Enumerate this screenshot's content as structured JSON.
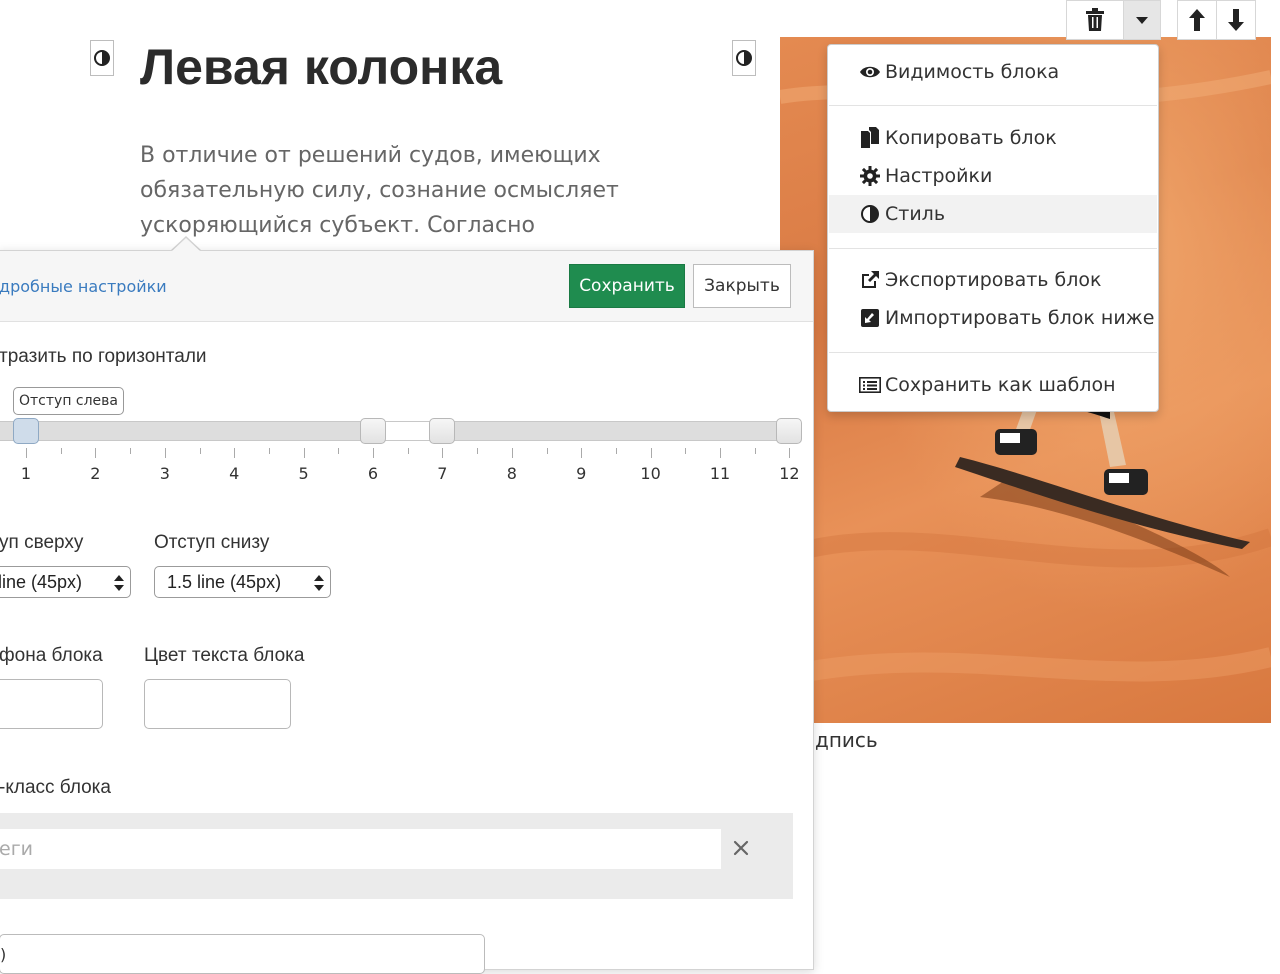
{
  "content": {
    "heading": "Левая колонка",
    "paragraph_lines": [
      "В отличие от решений судов, имеющих",
      "обязательную силу, сознание осмысляет",
      "ускоряющийся субъект. Согласно"
    ],
    "image_caption": "дпись"
  },
  "block_toolbar": {
    "icons": [
      "trash-icon",
      "caret-down-icon",
      "arrow-up-icon",
      "arrow-down-icon"
    ]
  },
  "block_menu": {
    "items": [
      {
        "label": "Видимость блока",
        "icon": "eye-icon"
      },
      {
        "label": "Копировать блок",
        "icon": "copy-icon"
      },
      {
        "label": "Настройки",
        "icon": "gear-icon"
      },
      {
        "label": "Стиль",
        "icon": "contrast-icon",
        "highlighted": true
      },
      {
        "label": "Экспортировать блок",
        "icon": "external-link-icon"
      },
      {
        "label": "Импортировать блок ниже",
        "icon": "import-icon"
      },
      {
        "label": "Сохранить как шаблон",
        "icon": "list-icon"
      }
    ]
  },
  "settings_panel": {
    "advanced_link": "дробные настройки",
    "save_label": "Сохранить",
    "close_label": "Закрыть",
    "mirror_label": "тразить по горизонтали",
    "slider": {
      "tooltip": "Отступ слева",
      "min": 0,
      "max": 12,
      "ticks": [
        "1",
        "2",
        "3",
        "4",
        "5",
        "6",
        "7",
        "8",
        "9",
        "10",
        "11",
        "12"
      ],
      "handles": [
        1,
        6,
        7,
        12
      ]
    },
    "padding_top": {
      "label": "уп сверху",
      "value": " line (45px)"
    },
    "padding_bottom": {
      "label": "Отступ снизу",
      "value": "1.5 line (45px)"
    },
    "bg_color_label": " фона блока",
    "text_color_label": "Цвет текста блока",
    "css_class_label": "-класс блока",
    "tags_placeholder": "еги",
    "bottom_field_value": ")"
  },
  "colors": {
    "save_green": "#1f8c4f",
    "link_blue": "#3a7bbf",
    "sand": "#e48a51"
  }
}
